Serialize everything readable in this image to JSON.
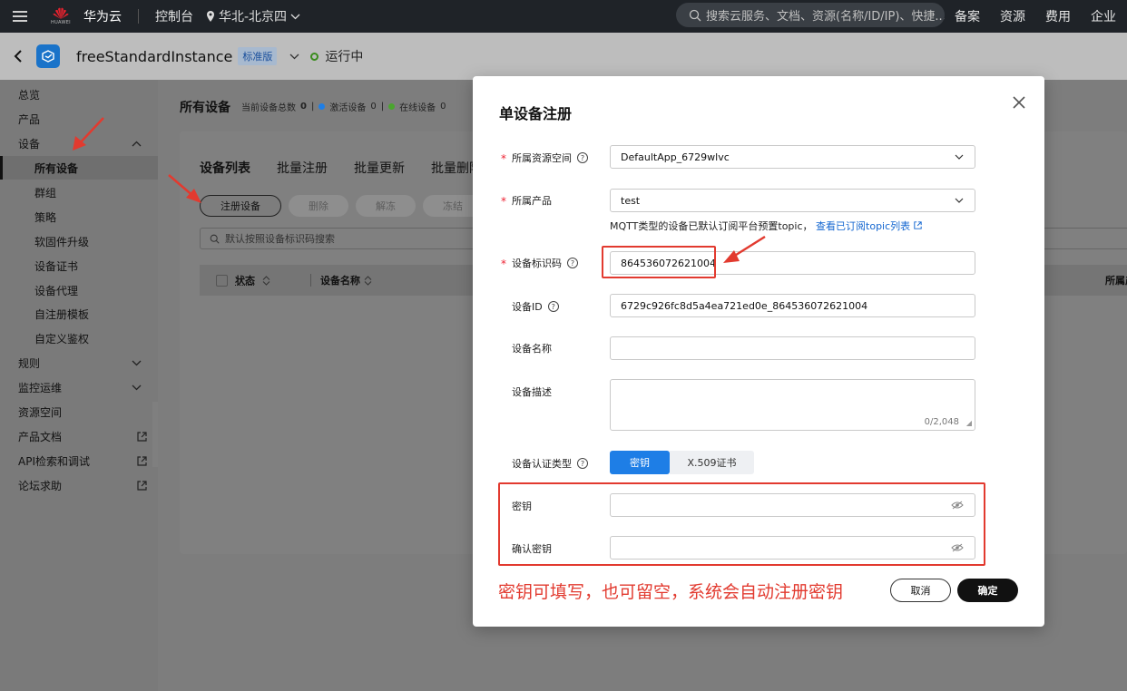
{
  "topbar": {
    "brand": "华为云",
    "logo_text": "HUAWEI",
    "console": "控制台",
    "region": "华北-北京四",
    "search_placeholder": "搜索云服务、文档、资源(名称/ID/IP)、快捷...",
    "links": [
      "备案",
      "资源",
      "费用",
      "企业"
    ]
  },
  "instance": {
    "name": "freeStandardInstance",
    "edition": "标准版",
    "status": "运行中",
    "status_color": "#3a8c1d"
  },
  "sidebar": {
    "items": [
      {
        "label": "总览"
      },
      {
        "label": "产品"
      },
      {
        "label": "设备"
      },
      {
        "label": "所有设备"
      },
      {
        "label": "群组"
      },
      {
        "label": "策略"
      },
      {
        "label": "软固件升级"
      },
      {
        "label": "设备证书"
      },
      {
        "label": "设备代理"
      },
      {
        "label": "自注册模板"
      },
      {
        "label": "自定义鉴权"
      },
      {
        "label": "规则"
      },
      {
        "label": "监控运维"
      },
      {
        "label": "资源空间"
      },
      {
        "label": "产品文档"
      },
      {
        "label": "API检索和调试"
      },
      {
        "label": "论坛求助"
      }
    ]
  },
  "main": {
    "title": "所有设备",
    "counts": {
      "total_label": "当前设备总数",
      "total": "0",
      "active_label": "激活设备",
      "active": "0",
      "online_label": "在线设备",
      "online": "0"
    },
    "tabs": [
      "设备列表",
      "批量注册",
      "批量更新",
      "批量删除"
    ],
    "actions": [
      "注册设备",
      "删除",
      "解冻",
      "冻结"
    ],
    "search_placeholder": "默认按照设备标识码搜索",
    "columns": [
      "状态",
      "设备名称",
      "所属产品"
    ]
  },
  "modal": {
    "title": "单设备注册",
    "resource_space": {
      "label": "所属资源空间",
      "value": "DefaultApp_6729wlvc"
    },
    "product": {
      "label": "所属产品",
      "value": "test"
    },
    "hint_text": "MQTT类型的设备已默认订阅平台预置topic，",
    "hint_link": "查看已订阅topic列表",
    "node_id": {
      "label": "设备标识码",
      "value": "864536072621004"
    },
    "device_id": {
      "label": "设备ID",
      "value": "6729c926fc8d5a4ea721ed0e_864536072621004"
    },
    "device_name": {
      "label": "设备名称",
      "value": ""
    },
    "description": {
      "label": "设备描述",
      "count": "0/2,048"
    },
    "auth_type": {
      "label": "设备认证类型",
      "options": [
        "密钥",
        "X.509证书"
      ],
      "selected": "密钥"
    },
    "secret": {
      "label": "密钥",
      "value": ""
    },
    "confirm_secret": {
      "label": "确认密钥",
      "value": ""
    },
    "note": "密钥可填写，也可留空，系统会自动注册密钥",
    "cancel": "取消",
    "ok": "确定"
  },
  "colors": {
    "accent": "#1e7ee6",
    "annotation_red": "#e23a2f",
    "active_dot": "#1e7ee6",
    "online_dot": "#4aa52e"
  }
}
